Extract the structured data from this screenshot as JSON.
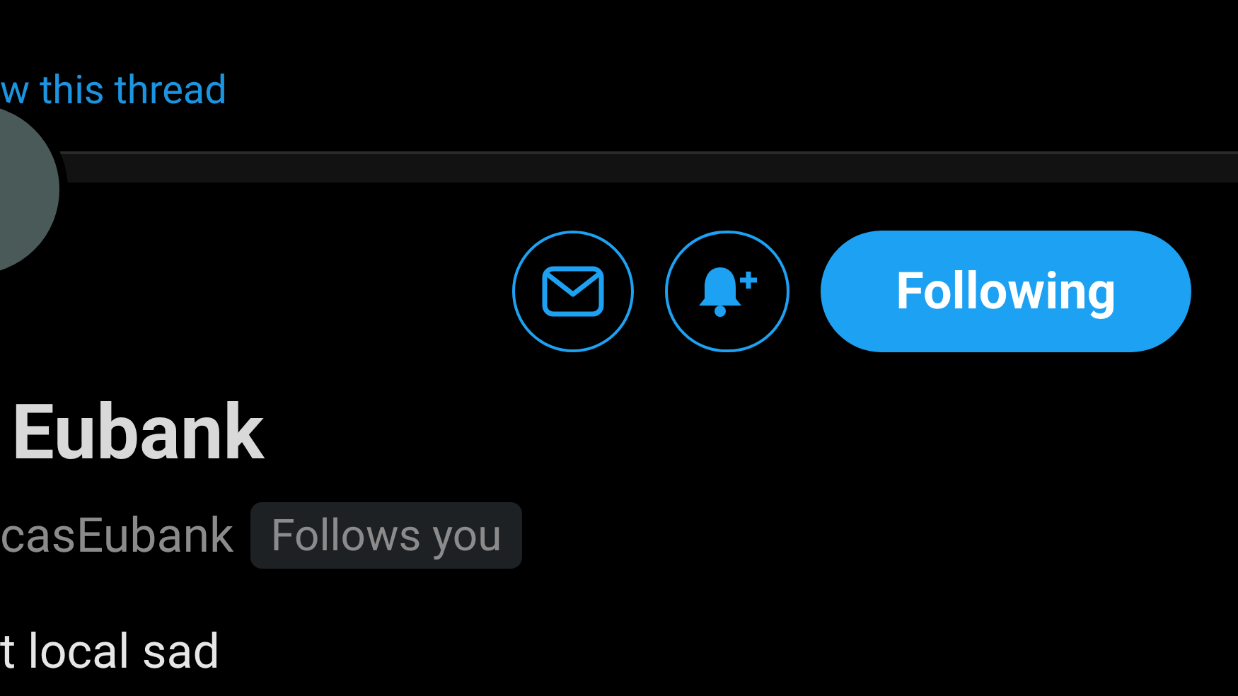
{
  "thread_link": "w this thread",
  "actions": [
    {
      "kind": "message"
    },
    {
      "kind": "notify"
    },
    {
      "kind": "follow",
      "label": "Following"
    }
  ],
  "profile": {
    "name": "Eubank",
    "handle": "casEubank",
    "badge": "Follows you",
    "bio": "t local sad"
  }
}
